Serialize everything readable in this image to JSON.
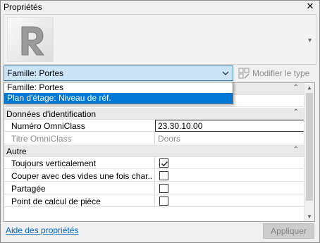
{
  "window": {
    "title": "Propriétés"
  },
  "header": {
    "logo_letter": "R"
  },
  "type_selector": {
    "selected": "Famille: Portes",
    "options": [
      "Famille: Portes",
      "Plan d'étage: Niveau de réf."
    ],
    "highlighted_index": 1
  },
  "modify_type": {
    "label": "Modifier le type"
  },
  "sections": [
    {
      "title": "Données d'identification",
      "rows": [
        {
          "name": "Numéro OmniClass",
          "value": "23.30.10.00",
          "editing": true
        },
        {
          "name": "Titre OmniClass",
          "value": "Doors",
          "readonly": true
        }
      ]
    },
    {
      "title": "Autre",
      "rows": [
        {
          "name": "Toujours verticalement",
          "checked": true
        },
        {
          "name": "Couper avec des vides une fois char...",
          "checked": false
        },
        {
          "name": "Partagée",
          "checked": false
        },
        {
          "name": "Point de calcul de pièce",
          "checked": false
        }
      ]
    }
  ],
  "footer": {
    "help_link": "Aide des propriétés",
    "apply_label": "Appliquer"
  },
  "colors": {
    "selection": "#0078d7",
    "select_bg": "#cce4f7",
    "link": "#0066cc"
  }
}
